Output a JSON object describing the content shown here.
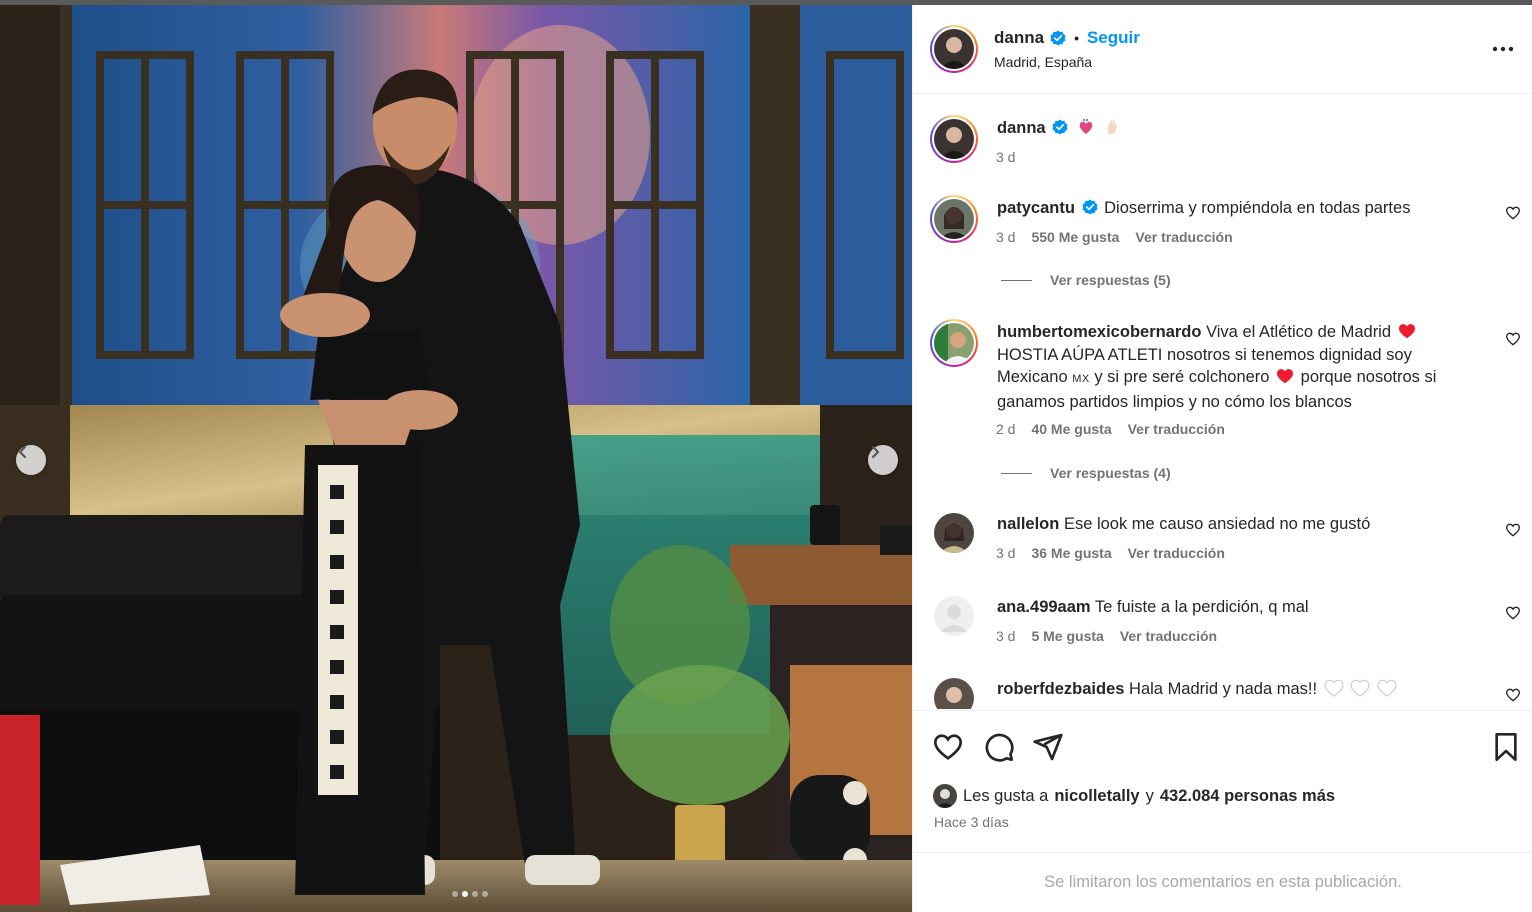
{
  "post": {
    "username": "danna",
    "follow_label": "Seguir",
    "location": "Madrid, España",
    "carousel": {
      "current": 2,
      "total": 4
    }
  },
  "caption": {
    "username": "danna",
    "emojis": [
      "anatomical-heart-emoji",
      "hand-emoji"
    ],
    "time": "3 d"
  },
  "comments": [
    {
      "username": "patycantu",
      "verified": true,
      "text": "Dioserrima y rompiéndola en todas partes",
      "time": "3 d",
      "likes": "550 Me gusta",
      "translate": "Ver traducción",
      "replies": "Ver respuestas (5)"
    },
    {
      "username": "humbertomexicobernardo",
      "text_1": "Viva el Atlético de Madrid",
      "text_2": "HOSTIA AÚPA ATLETI nosotros si tenemos dignidad soy Mexicano",
      "flag": "MX",
      "text_3": "y si pre seré colchonero",
      "text_4": "porque nosotros si ganamos partidos limpios y no cómo los blancos",
      "time": "2 d",
      "likes": "40 Me gusta",
      "translate": "Ver traducción",
      "replies": "Ver respuestas (4)"
    },
    {
      "username": "nallelon",
      "text": "Ese look me causo ansiedad no me gustó",
      "time": "3 d",
      "likes": "36 Me gusta",
      "translate": "Ver traducción"
    },
    {
      "username": "ana.499aam",
      "text": "Te fuiste a la perdición, q mal",
      "time": "3 d",
      "likes": "5 Me gusta",
      "translate": "Ver traducción"
    },
    {
      "username": "roberfdezbaides",
      "text": "Hala Madrid y nada mas!!"
    }
  ],
  "likes": {
    "prefix": "Les gusta a",
    "user": "nicolletally",
    "connector": "y",
    "others": "432.084 personas más"
  },
  "time_ago": "Hace 3 días",
  "comments_limited": "Se limitaron los comentarios en esta publicación.",
  "colors": {
    "link_blue": "#0095f6",
    "verified_blue": "#0095f6",
    "text_primary": "#262626",
    "text_secondary": "#737373",
    "red_heart": "#ed1c2e"
  }
}
